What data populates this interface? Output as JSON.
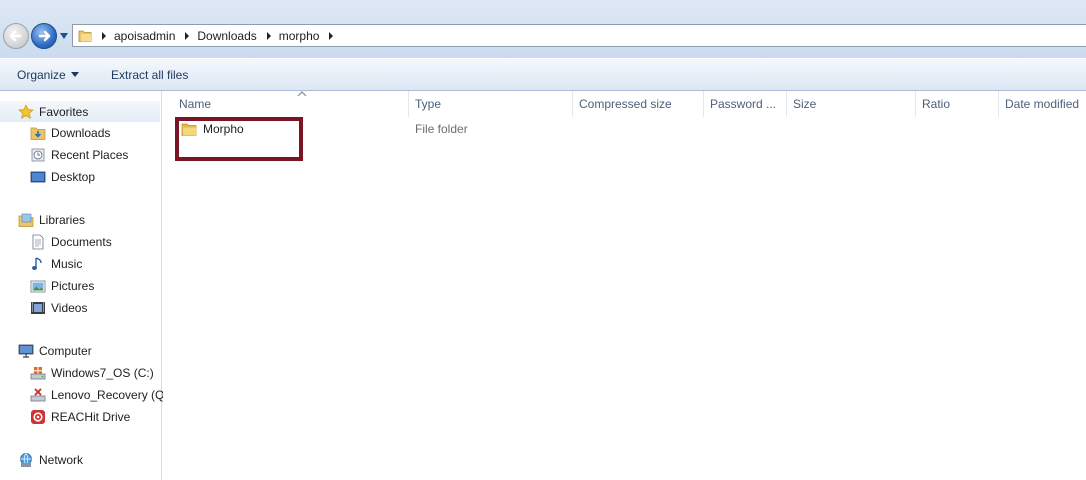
{
  "address_bar": {
    "breadcrumbs": [
      "apoisadmin",
      "Downloads",
      "morpho"
    ],
    "icon": "folder-icon"
  },
  "toolbar": {
    "organize_label": "Organize",
    "extract_label": "Extract all files"
  },
  "nav_pane": {
    "favorites": {
      "label": "Favorites",
      "icon": "star-icon",
      "items": [
        {
          "label": "Downloads",
          "icon": "downloads-folder-icon"
        },
        {
          "label": "Recent Places",
          "icon": "recent-places-icon"
        },
        {
          "label": "Desktop",
          "icon": "desktop-icon"
        }
      ]
    },
    "libraries": {
      "label": "Libraries",
      "icon": "libraries-icon",
      "items": [
        {
          "label": "Documents",
          "icon": "documents-icon"
        },
        {
          "label": "Music",
          "icon": "music-icon"
        },
        {
          "label": "Pictures",
          "icon": "pictures-icon"
        },
        {
          "label": "Videos",
          "icon": "videos-icon"
        }
      ]
    },
    "computer": {
      "label": "Computer",
      "icon": "computer-icon",
      "items": [
        {
          "label": "Windows7_OS (C:)",
          "icon": "system-drive-icon"
        },
        {
          "label": "Lenovo_Recovery (Q",
          "icon": "recovery-drive-icon"
        },
        {
          "label": "REACHit Drive",
          "icon": "reachit-drive-icon"
        }
      ]
    },
    "network": {
      "label": "Network",
      "icon": "network-icon"
    }
  },
  "file_list": {
    "columns": [
      "Name",
      "Type",
      "Compressed size",
      "Password ...",
      "Size",
      "Ratio",
      "Date modified"
    ],
    "sorted_column": "Name",
    "rows": [
      {
        "name": "Morpho",
        "type": "File folder",
        "icon": "folder-icon",
        "highlighted": true
      }
    ]
  },
  "colors": {
    "highlight_border": "#7b1425",
    "toolbar_text": "#1e395b",
    "column_header_text": "#4c607a"
  }
}
